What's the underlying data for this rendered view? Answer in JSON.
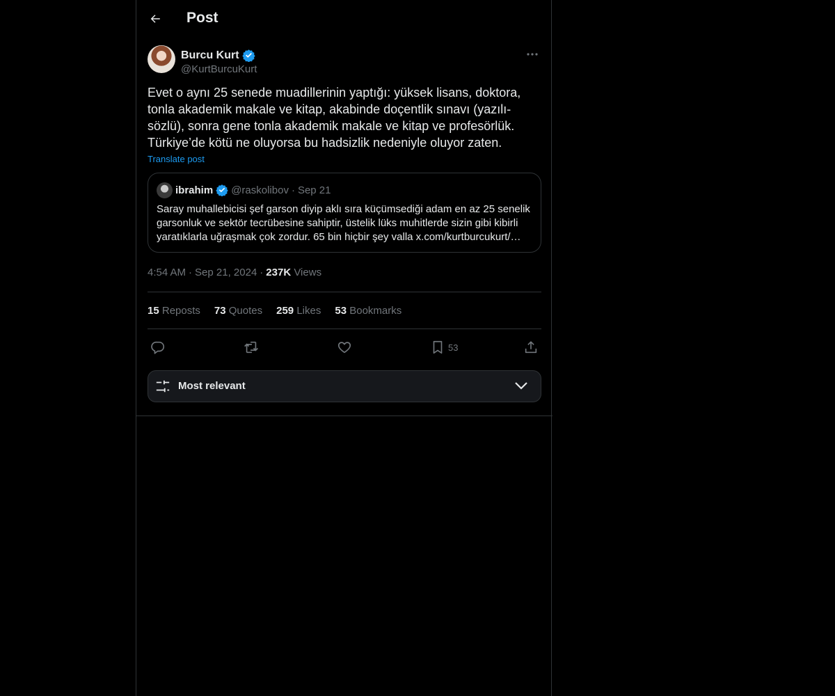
{
  "header": {
    "title": "Post"
  },
  "post": {
    "author_name": "Burcu Kurt",
    "author_handle": "@KurtBurcuKurt",
    "text": "Evet o aynı 25 senede muadillerinin yaptığı: yüksek lisans, doktora, tonla akademik makale ve kitap, akabinde doçentlik sınavı (yazılı-sözlü), sonra gene tonla akademik makale ve kitap ve profesörlük. Türkiye’de kötü ne oluyorsa bu hadsizlik nedeniyle oluyor zaten.",
    "translate_label": "Translate post",
    "quote": {
      "name": "ibrahim",
      "handle": "@raskolibov",
      "dot": "·",
      "date": "Sep 21",
      "text": "Saray muhallebicisi şef garson diyip aklı sıra küçümsediği adam en az 25 senelik garsonluk ve sektör tecrübesine sahiptir, üstelik lüks muhitlerde sizin gibi kibirli yaratıklarla uğraşmak çok zordur. 65 bin hiçbir şey valla x.com/kurtburcukurt/…"
    },
    "time": "4:54 AM",
    "date": "Sep 21, 2024",
    "views_count": "237K",
    "views_label": "Views",
    "sep": "·"
  },
  "stats": {
    "reposts_count": "15",
    "reposts_label": "Reposts",
    "quotes_count": "73",
    "quotes_label": "Quotes",
    "likes_count": "259",
    "likes_label": "Likes",
    "bookmarks_count": "53",
    "bookmarks_label": "Bookmarks"
  },
  "actions": {
    "bookmark_count": "53"
  },
  "sort": {
    "label": "Most relevant"
  },
  "colors": {
    "accent": "#1d9bf0",
    "verified": "#1d9bf0",
    "background": "#000000",
    "border": "#2f3336"
  }
}
